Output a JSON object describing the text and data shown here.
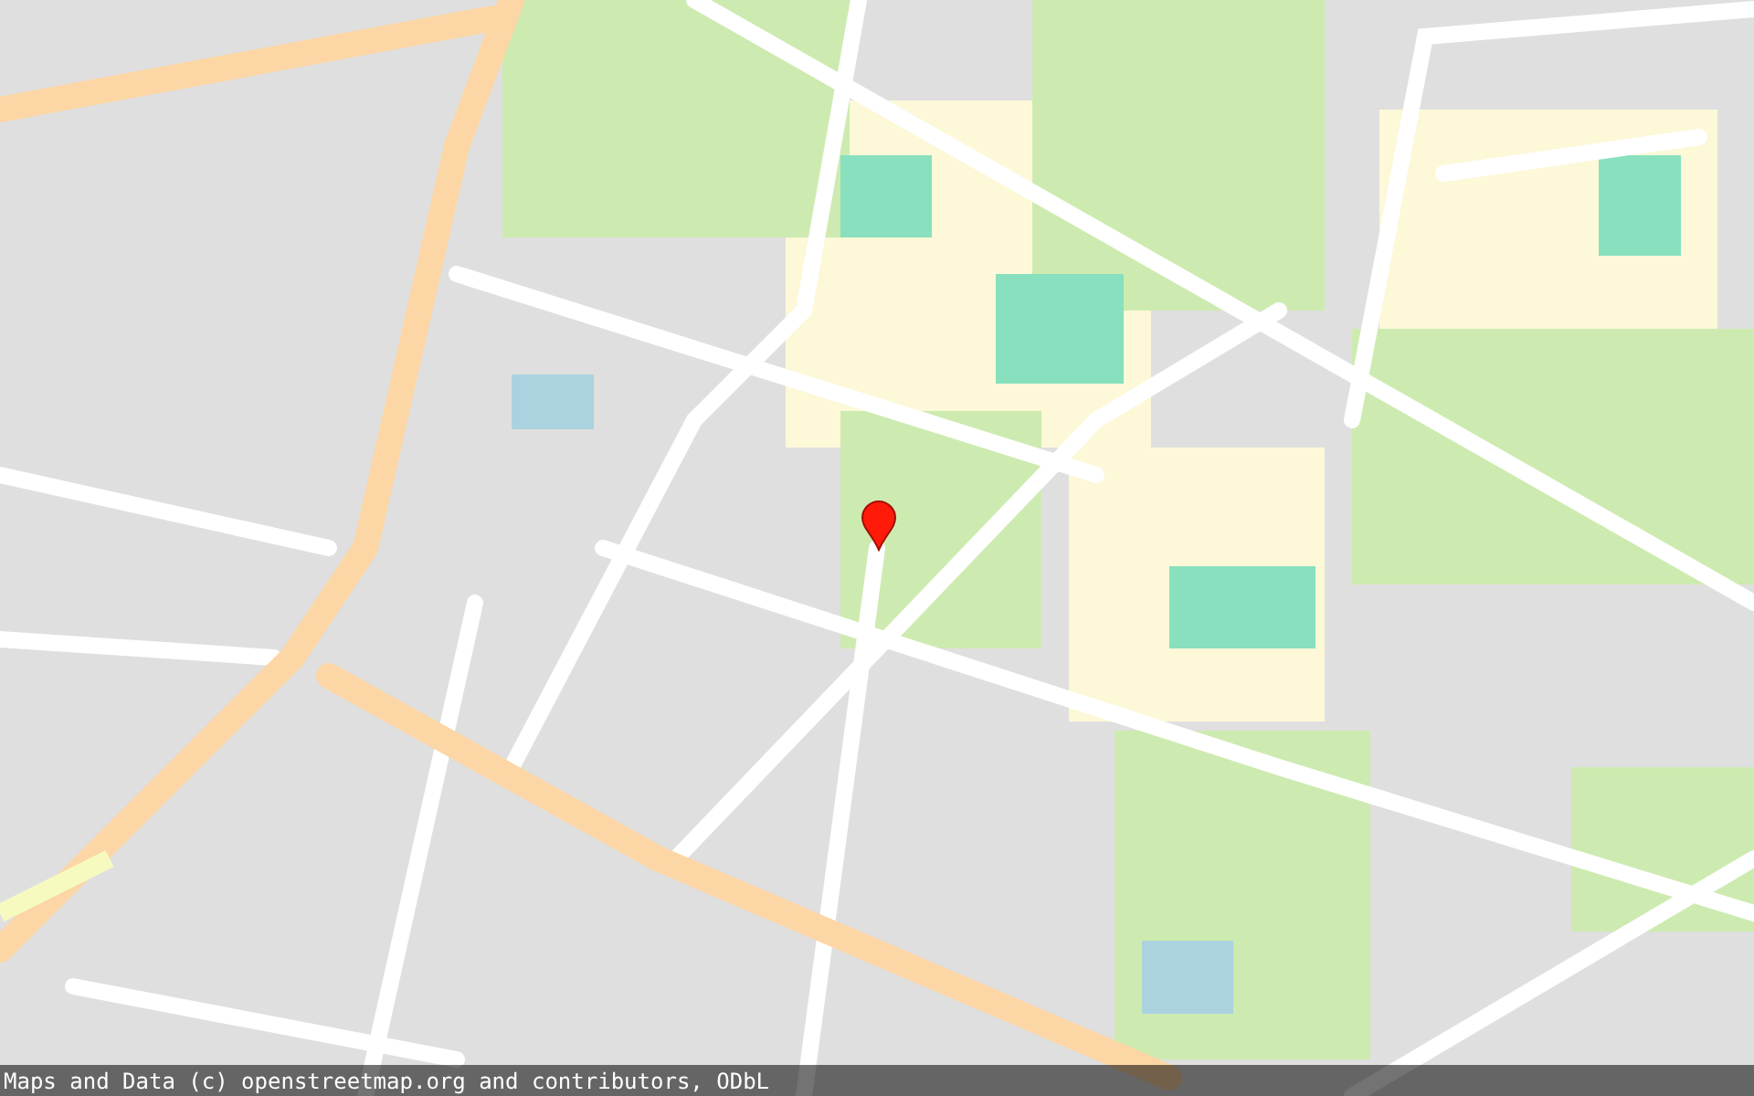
{
  "attribution": {
    "text": "Maps and Data (c) openstreetmap.org and contributors, ODbL"
  }
}
